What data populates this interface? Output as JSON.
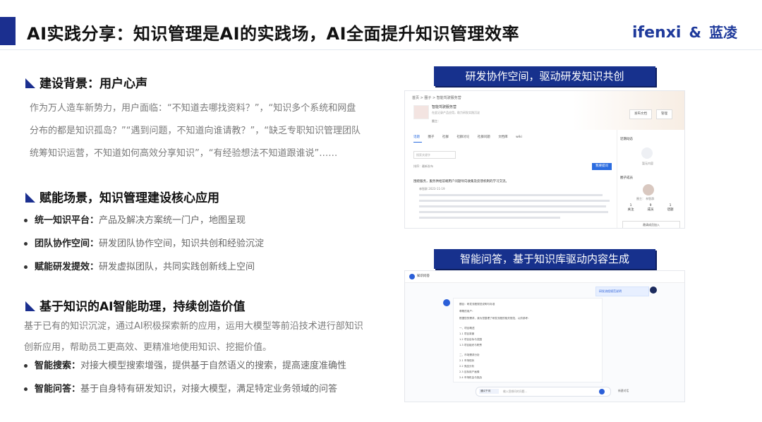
{
  "header": {
    "title": "AI实践分享：知识管理是AI的实践场，AI全面提升知识管理效率",
    "logo_main": "ifenxi",
    "logo_amp": "&",
    "logo_partner": "蓝凌"
  },
  "colors": {
    "brand": "#1b2f8f",
    "banner": "#17318d",
    "text_gray": "#7a7a7a"
  },
  "section1": {
    "title": "建设背景：用户心声",
    "body": "作为万人造车新势力，用户面临：“不知道去哪找资料？”，“知识多个系统和网盘分布的都是知识孤岛？”“遇到问题，不知道向谁请教？”，“缺乏专职知识管理团队统筹知识运营，不知道如何高效分享知识”，“有经验想法不知道跟谁说”……"
  },
  "section2": {
    "title": "赋能场景，知识管理建设核心应用",
    "bullets": [
      {
        "label": "统一知识平台：",
        "text": "产品及解决方案统一门户，地图呈现"
      },
      {
        "label": "团队协作空间：",
        "text": "研发团队协作空间，知识共创和经验沉淀"
      },
      {
        "label": "赋能研发提效：",
        "text": "研发虚拟团队，共同实践创新线上空间"
      }
    ]
  },
  "section3": {
    "title": "基于知识的AI智能助理，持续创造价值",
    "body": "基于已有的知识沉淀，通过AI积极探索新的应用，运用大模型等前沿技术进行部知识创新应用，帮助员工更高效、更精准地使用知识、挖掘价值。",
    "bullets": [
      {
        "label": "智能搜索：",
        "text": "对接大模型搜索增强，提供基于自然语义的搜索，提高速度准确性"
      },
      {
        "label": "智能问答：",
        "text": "基于自身特有研发知识，对接大模型，满足特定业务领域的问答"
      }
    ]
  },
  "right": {
    "banner1": "研发协作空间，驱动研发知识共创",
    "banner2": "智能问答，基于知识库驱动内容生成",
    "shot1": {
      "breadcrumb": "首页 > 圈子 > 智能驾驶服务营",
      "space_name": "智能驾驶服务营",
      "space_desc": "在此记录产品应用，助力研发实践沉淀",
      "meta": "圈主：",
      "btn_publish": "发布文档",
      "btn_manage": "管理",
      "tabs": [
        "话题",
        "圈子",
        "社群",
        "社群讨论",
        "社群问题",
        "文档库",
        "wiki"
      ],
      "search_placeholder": "搜索关键字",
      "filter": "排序：最新发布",
      "ask_button": "我要提问",
      "post_title": "围绕服务，服务供给前端用户问题导向收集及反馈机制的学习交流。",
      "author": "林智群  2023-11-19",
      "side_title1": "近期动态",
      "side_title2": "圈子成员",
      "side_note": "暂无内容",
      "owner": "圈主：  林智群",
      "stats": [
        {
          "value": "1",
          "label": "关注"
        },
        {
          "value": "9",
          "label": "成员"
        },
        {
          "value": "1",
          "label": "话题"
        }
      ],
      "join": "邀请成员加入"
    },
    "shot2": {
      "app_name": "知识问答",
      "user_question": "研发流程规范说明",
      "answer_lines": [
        "题目：研发流程规范说明与标准",
        "尊敬的用户：",
        "根据您的需求，我为您整理了研发流程的相关规范，以供参考：",
        "一、项目概述",
        "1.1 项目背景",
        "1.2 项目目标与范围",
        "1.3 项目组织与职责",
        "二、市场需求分析",
        "2.1 市场现状",
        "2.2 竞品分析",
        "2.3 目标用户画像",
        "2.4 市场机会与挑战"
      ],
      "mode": "通义千问",
      "input_placeholder": "输入您想问的问题…",
      "side_label": "新建对话"
    }
  }
}
